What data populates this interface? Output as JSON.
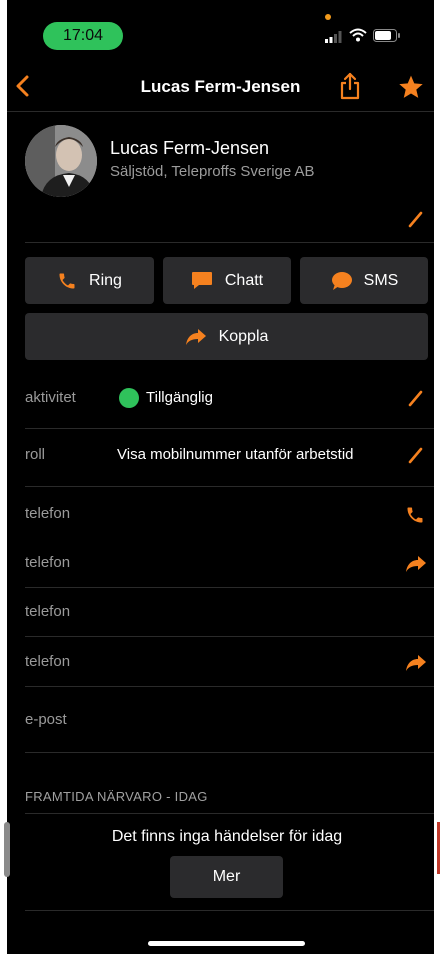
{
  "status_bar": {
    "time": "17:04"
  },
  "nav": {
    "title": "Lucas Ferm-Jensen"
  },
  "profile": {
    "name": "Lucas Ferm-Jensen",
    "subtitle": "Säljstöd, Teleproffs Sverige AB"
  },
  "actions": {
    "ring": "Ring",
    "chat": "Chatt",
    "sms": "SMS",
    "transfer": "Koppla"
  },
  "details": [
    {
      "label": "aktivitet",
      "value": "Tillgänglig"
    },
    {
      "label": "roll",
      "value": "Visa mobilnummer utanför arbetstid"
    },
    {
      "label": "telefon",
      "value": ""
    },
    {
      "label": "telefon",
      "value": ""
    },
    {
      "label": "telefon",
      "value": ""
    },
    {
      "label": "telefon",
      "value": ""
    },
    {
      "label": "e-post",
      "value": ""
    }
  ],
  "presence": {
    "heading": "FRAMTIDA NÄRVARO - IDAG",
    "empty_text": "Det finns inga händelser för idag",
    "more_label": "Mer"
  },
  "colors": {
    "accent": "#f5811f",
    "available": "#2fc25b",
    "background": "#000000",
    "button": "#2b2b2d"
  },
  "icons": [
    "back-chevron-icon",
    "share-icon",
    "star-icon",
    "edit-pencil-icon",
    "phone-icon",
    "chat-bubble-icon",
    "sms-bubble-icon",
    "forward-arrow-icon"
  ]
}
